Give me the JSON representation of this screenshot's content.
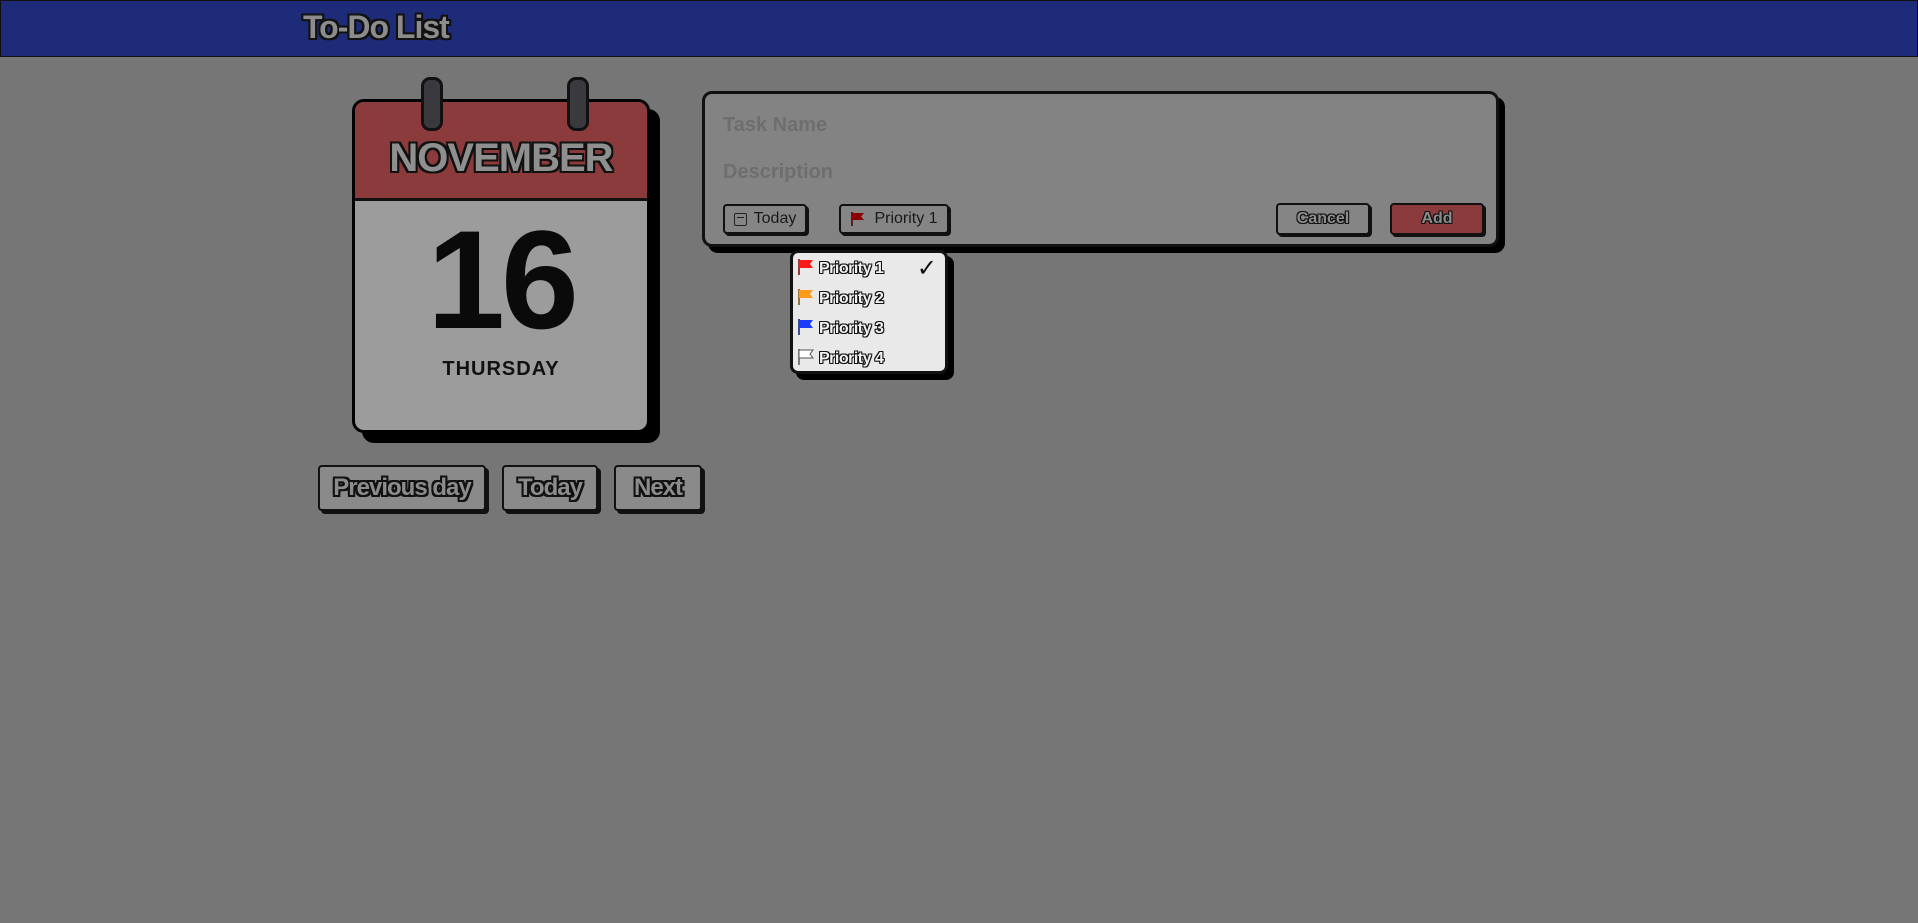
{
  "app": {
    "title": "To-Do List"
  },
  "calendar": {
    "month": "NOVEMBER",
    "day": "16",
    "weekday": "THURSDAY",
    "header_color": "#8b3b3b"
  },
  "nav": {
    "previous_label": "Previous day",
    "today_label": "Today",
    "next_label": "Next"
  },
  "task_form": {
    "task_name_placeholder": "Task Name",
    "description_placeholder": "Description",
    "date_button_label": "Today",
    "date_icon": "calendar-icon",
    "priority_button_label": "Priority 1",
    "priority_icon": "flag-icon",
    "cancel_label": "Cancel",
    "add_label": "Add",
    "add_color": "#8b3b3b"
  },
  "priority_menu": {
    "selected_mark": "✓",
    "items": [
      {
        "label": "Priority 1",
        "color": "#ff1a1a",
        "selected": true
      },
      {
        "label": "Priority 2",
        "color": "#ff9a1a",
        "selected": false
      },
      {
        "label": "Priority 3",
        "color": "#1a3cff",
        "selected": false
      },
      {
        "label": "Priority 4",
        "color": "#ffffff",
        "selected": false
      }
    ]
  }
}
